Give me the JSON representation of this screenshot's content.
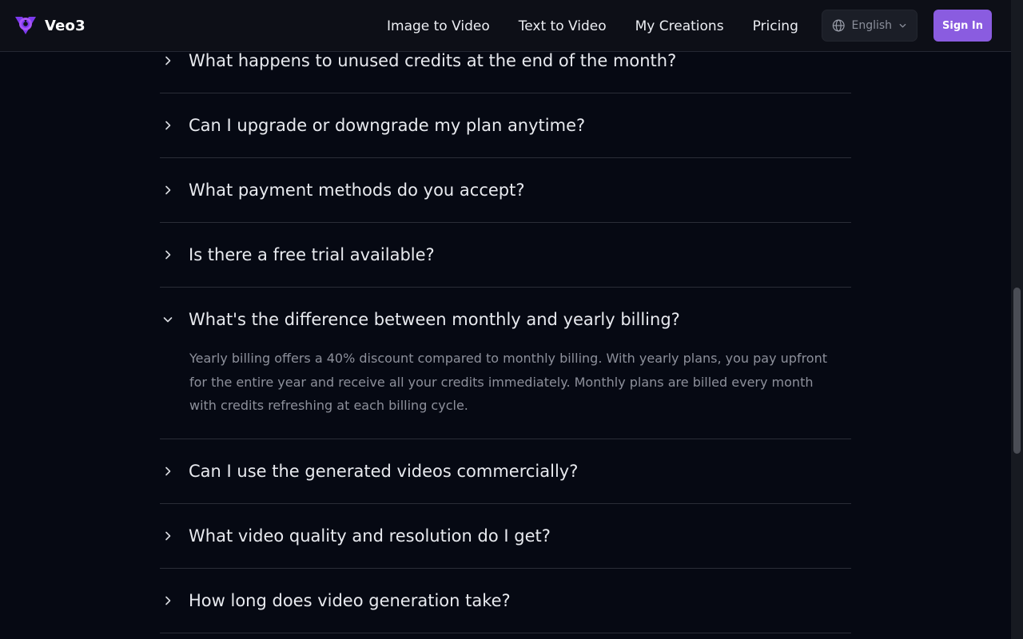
{
  "header": {
    "brand": "Veo3",
    "nav": [
      {
        "label": "Image to Video"
      },
      {
        "label": "Text to Video"
      },
      {
        "label": "My Creations"
      },
      {
        "label": "Pricing"
      }
    ],
    "language": {
      "selected": "English",
      "icon": "globe-icon"
    },
    "sign_in_label": "Sign In"
  },
  "faq": {
    "items": [
      {
        "question": "What happens to unused credits at the end of the month?",
        "expanded": false
      },
      {
        "question": "Can I upgrade or downgrade my plan anytime?",
        "expanded": false
      },
      {
        "question": "What payment methods do you accept?",
        "expanded": false
      },
      {
        "question": "Is there a free trial available?",
        "expanded": false
      },
      {
        "question": "What's the difference between monthly and yearly billing?",
        "expanded": true,
        "answer": "Yearly billing offers a 40% discount compared to monthly billing. With yearly plans, you pay upfront for the entire year and receive all your credits immediately. Monthly plans are billed every month with credits refreshing at each billing cycle."
      },
      {
        "question": "Can I use the generated videos commercially?",
        "expanded": false
      },
      {
        "question": "What video quality and resolution do I get?",
        "expanded": false
      },
      {
        "question": "How long does video generation take?",
        "expanded": false
      }
    ]
  },
  "colors": {
    "background": "#060913",
    "accent": "#8a5ce0",
    "logo": "#7c3aed"
  }
}
